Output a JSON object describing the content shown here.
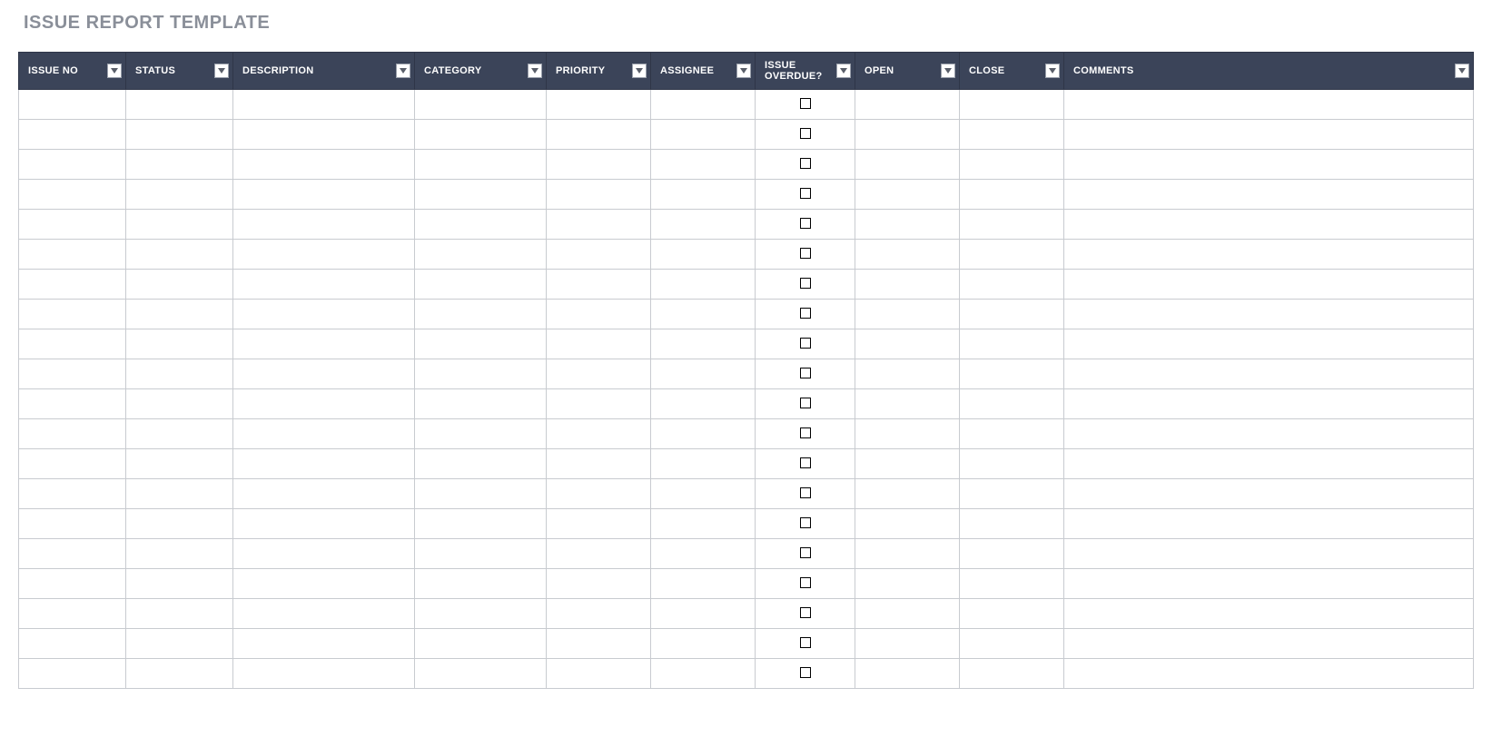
{
  "page": {
    "title": "ISSUE REPORT TEMPLATE"
  },
  "table": {
    "columns": [
      {
        "key": "issue_no",
        "label": "ISSUE NO"
      },
      {
        "key": "status",
        "label": "STATUS"
      },
      {
        "key": "description",
        "label": "DESCRIPTION"
      },
      {
        "key": "category",
        "label": "CATEGORY"
      },
      {
        "key": "priority",
        "label": "PRIORITY"
      },
      {
        "key": "assignee",
        "label": "ASSIGNEE"
      },
      {
        "key": "overdue",
        "label": "ISSUE OVERDUE?"
      },
      {
        "key": "open",
        "label": "OPEN"
      },
      {
        "key": "close",
        "label": "CLOSE"
      },
      {
        "key": "comments",
        "label": "COMMENTS"
      }
    ],
    "rows": [
      {
        "issue_no": "",
        "status": "",
        "description": "",
        "category": "",
        "priority": "",
        "assignee": "",
        "overdue": false,
        "open": "",
        "close": "",
        "comments": ""
      },
      {
        "issue_no": "",
        "status": "",
        "description": "",
        "category": "",
        "priority": "",
        "assignee": "",
        "overdue": false,
        "open": "",
        "close": "",
        "comments": ""
      },
      {
        "issue_no": "",
        "status": "",
        "description": "",
        "category": "",
        "priority": "",
        "assignee": "",
        "overdue": false,
        "open": "",
        "close": "",
        "comments": ""
      },
      {
        "issue_no": "",
        "status": "",
        "description": "",
        "category": "",
        "priority": "",
        "assignee": "",
        "overdue": false,
        "open": "",
        "close": "",
        "comments": ""
      },
      {
        "issue_no": "",
        "status": "",
        "description": "",
        "category": "",
        "priority": "",
        "assignee": "",
        "overdue": false,
        "open": "",
        "close": "",
        "comments": ""
      },
      {
        "issue_no": "",
        "status": "",
        "description": "",
        "category": "",
        "priority": "",
        "assignee": "",
        "overdue": false,
        "open": "",
        "close": "",
        "comments": ""
      },
      {
        "issue_no": "",
        "status": "",
        "description": "",
        "category": "",
        "priority": "",
        "assignee": "",
        "overdue": false,
        "open": "",
        "close": "",
        "comments": ""
      },
      {
        "issue_no": "",
        "status": "",
        "description": "",
        "category": "",
        "priority": "",
        "assignee": "",
        "overdue": false,
        "open": "",
        "close": "",
        "comments": ""
      },
      {
        "issue_no": "",
        "status": "",
        "description": "",
        "category": "",
        "priority": "",
        "assignee": "",
        "overdue": false,
        "open": "",
        "close": "",
        "comments": ""
      },
      {
        "issue_no": "",
        "status": "",
        "description": "",
        "category": "",
        "priority": "",
        "assignee": "",
        "overdue": false,
        "open": "",
        "close": "",
        "comments": ""
      },
      {
        "issue_no": "",
        "status": "",
        "description": "",
        "category": "",
        "priority": "",
        "assignee": "",
        "overdue": false,
        "open": "",
        "close": "",
        "comments": ""
      },
      {
        "issue_no": "",
        "status": "",
        "description": "",
        "category": "",
        "priority": "",
        "assignee": "",
        "overdue": false,
        "open": "",
        "close": "",
        "comments": ""
      },
      {
        "issue_no": "",
        "status": "",
        "description": "",
        "category": "",
        "priority": "",
        "assignee": "",
        "overdue": false,
        "open": "",
        "close": "",
        "comments": ""
      },
      {
        "issue_no": "",
        "status": "",
        "description": "",
        "category": "",
        "priority": "",
        "assignee": "",
        "overdue": false,
        "open": "",
        "close": "",
        "comments": ""
      },
      {
        "issue_no": "",
        "status": "",
        "description": "",
        "category": "",
        "priority": "",
        "assignee": "",
        "overdue": false,
        "open": "",
        "close": "",
        "comments": ""
      },
      {
        "issue_no": "",
        "status": "",
        "description": "",
        "category": "",
        "priority": "",
        "assignee": "",
        "overdue": false,
        "open": "",
        "close": "",
        "comments": ""
      },
      {
        "issue_no": "",
        "status": "",
        "description": "",
        "category": "",
        "priority": "",
        "assignee": "",
        "overdue": false,
        "open": "",
        "close": "",
        "comments": ""
      },
      {
        "issue_no": "",
        "status": "",
        "description": "",
        "category": "",
        "priority": "",
        "assignee": "",
        "overdue": false,
        "open": "",
        "close": "",
        "comments": ""
      },
      {
        "issue_no": "",
        "status": "",
        "description": "",
        "category": "",
        "priority": "",
        "assignee": "",
        "overdue": false,
        "open": "",
        "close": "",
        "comments": ""
      },
      {
        "issue_no": "",
        "status": "",
        "description": "",
        "category": "",
        "priority": "",
        "assignee": "",
        "overdue": false,
        "open": "",
        "close": "",
        "comments": ""
      }
    ]
  },
  "colors": {
    "header_bg": "#3b4459",
    "title_fg": "#8a8f99",
    "grid": "#c8cbd0"
  }
}
